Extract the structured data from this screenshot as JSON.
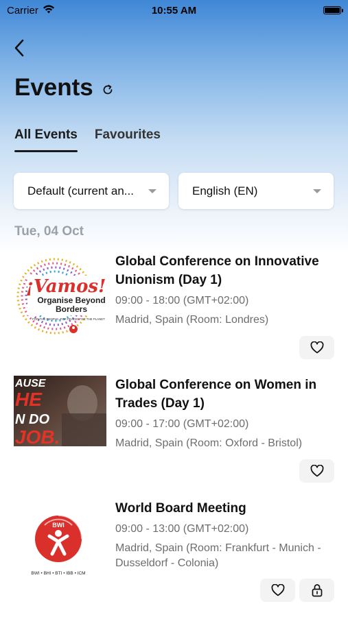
{
  "status_bar": {
    "carrier": "Carrier",
    "time": "10:55 AM"
  },
  "header": {
    "title": "Events"
  },
  "tabs": [
    {
      "label": "All Events",
      "active": true
    },
    {
      "label": "Favourites",
      "active": false
    }
  ],
  "filters": {
    "period": "Default (current an...",
    "language": "English (EN)"
  },
  "date_header": "Tue, 04 Oct",
  "events": [
    {
      "title": "Global Conference on Innovative Unionism (Day 1)",
      "time": "09:00 - 18:00 (GMT+02:00)",
      "location": "Madrid, Spain (Room: Londres)",
      "image": {
        "headline": "¡Vamos!",
        "line2": "Organise Beyond",
        "line3": "Borders",
        "tagline": "FOR THE PEOPLE. FOR PEACE. FOR THE PLANET"
      },
      "actions": [
        "heart-icon"
      ]
    },
    {
      "title": "Global Conference on Women in Trades (Day 1)",
      "time": "09:00 - 17:00 (GMT+02:00)",
      "location": "Madrid, Spain (Room: Oxford - Bristol)",
      "image": {
        "line1": "AUSE",
        "line2": "HE",
        "line3": "N DO",
        "line4": "JOB."
      },
      "actions": [
        "heart-icon"
      ]
    },
    {
      "title": "World Board Meeting",
      "time": "09:00 - 13:00 (GMT+02:00)",
      "location": "Madrid, Spain (Room: Frankfurt - Munich - Dusseldorf - Colonia)",
      "image": {
        "logo_text": "BWI",
        "caption": "BWI • BHI • BTI • IBB • ICM"
      },
      "actions": [
        "heart-icon",
        "lock-icon"
      ]
    }
  ],
  "colors": {
    "accent_blue": "#3f87d6",
    "bwi_red": "#d9302b",
    "muted_text": "#6d6d6d"
  }
}
